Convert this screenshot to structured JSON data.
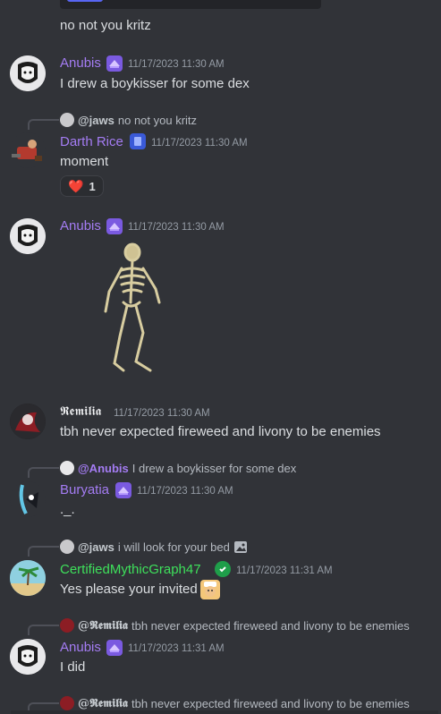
{
  "top_message": "no not you kritz",
  "messages": [
    {
      "author": "Anubis",
      "timestamp": "11/17/2023 11:30 AM",
      "text": "I drew a boykisser for some dex"
    },
    {
      "reply": {
        "name": "@jaws",
        "text": "no not you kritz"
      },
      "author": "Darth Rice",
      "timestamp": "11/17/2023 11:30 AM",
      "text": "moment",
      "reaction": {
        "emoji": "❤️",
        "count": "1"
      }
    },
    {
      "author": "Anubis",
      "timestamp": "11/17/2023 11:30 AM",
      "image": "skeleton-image"
    },
    {
      "author": "𝕽𝖊𝖒𝖎𝖑𝖎𝖆",
      "timestamp": "11/17/2023 11:30 AM",
      "text": "tbh never expected fireweed and livony to be enemies"
    },
    {
      "reply": {
        "name": "@Anubis",
        "text": "I drew a boykisser for some dex"
      },
      "author": "Buryatia",
      "timestamp": "11/17/2023 11:30 AM",
      "text": "._."
    },
    {
      "reply": {
        "name": "@jaws",
        "text": "i will look for your bed"
      },
      "author": "CertifiedMythicGraph47",
      "timestamp": "11/17/2023 11:31 AM",
      "text": "Yes please your invited"
    },
    {
      "reply": {
        "name": "@𝕽𝖊𝖒𝖎𝖑𝖎𝖆",
        "text": "tbh never expected fireweed and livony to be enemies"
      },
      "author": "Anubis",
      "timestamp": "11/17/2023 11:31 AM",
      "text": "I did"
    },
    {
      "reply": {
        "name": "@𝕽𝖊𝖒𝖎𝖑𝖎𝖆",
        "text": "tbh never expected fireweed and livony to be enemies"
      }
    }
  ],
  "colors": {
    "background": "#313338",
    "anubis": "#a47cf3",
    "darth_rice": "#a47cf3",
    "remilia": "#f2f3f5",
    "buryatia": "#a47cf3",
    "certified": "#3ee05b",
    "timestamp": "#949ba4"
  }
}
